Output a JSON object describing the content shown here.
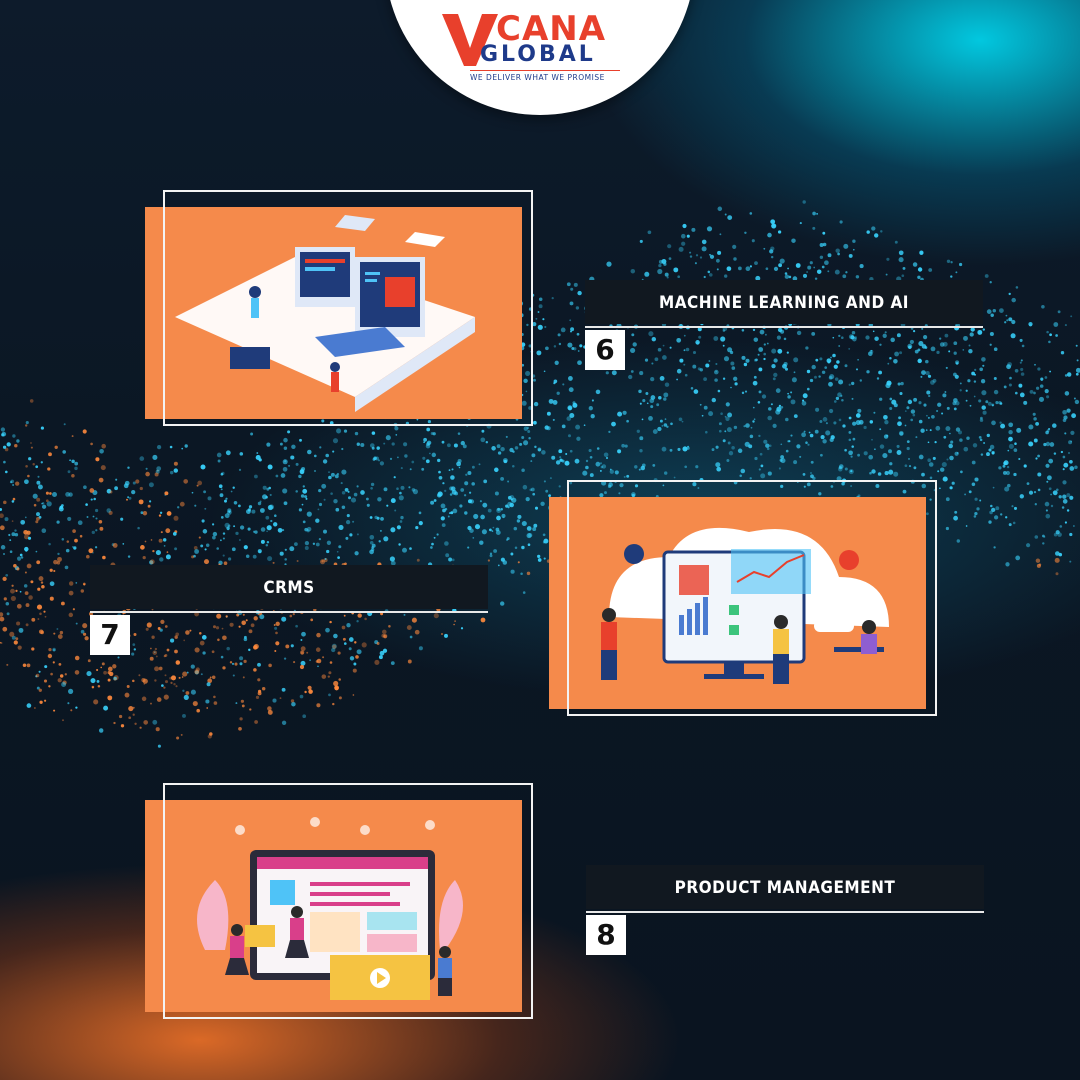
{
  "brand": {
    "logo_text_top": "CANA",
    "logo_text_v": "V",
    "logo_text_bottom": "GLOBAL",
    "tagline": "WE DELIVER WHAT WE PROMISE",
    "colors": {
      "red": "#e8402c",
      "navy": "#1e3a8a"
    }
  },
  "items": [
    {
      "number": "6",
      "title": "MACHINE LEARNING AND AI",
      "icon": "developer-workstation-illustration"
    },
    {
      "number": "7",
      "title": "CRMS",
      "icon": "crm-dashboard-illustration"
    },
    {
      "number": "8",
      "title": "PRODUCT MANAGEMENT",
      "icon": "web-product-design-illustration"
    }
  ],
  "colors": {
    "card_orange": "#f58a4b",
    "title_bar": "#111820",
    "cyan_glow": "#00e6ff",
    "orange_glow": "#ff7828"
  }
}
